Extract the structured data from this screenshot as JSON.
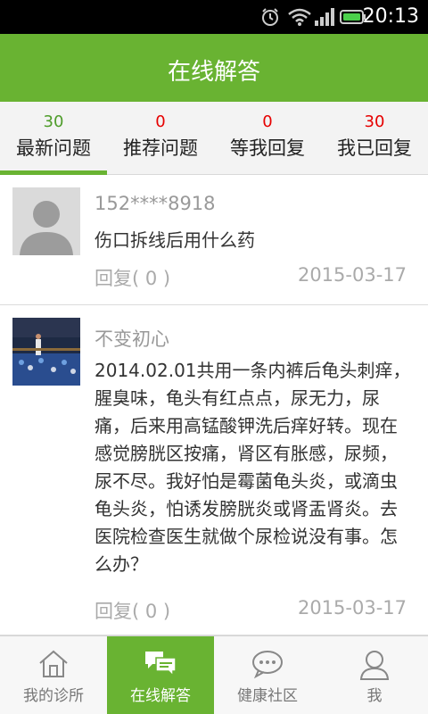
{
  "status_bar": {
    "time": "20:13"
  },
  "header": {
    "title": "在线解答"
  },
  "tabs": [
    {
      "count": "30",
      "label": "最新问题",
      "active": true
    },
    {
      "count": "0",
      "label": "推荐问题"
    },
    {
      "count": "0",
      "label": "等我回复"
    },
    {
      "count": "30",
      "label": "我已回复"
    }
  ],
  "questions": [
    {
      "user": "152****8918",
      "text": "伤口拆线后用什么药",
      "reply": "回复( 0 )",
      "date": "2015-03-17"
    },
    {
      "user": "不变初心",
      "text": "2014.02.01共用一条内裤后龟头刺痒，腥臭味，龟头有红点点，尿无力，尿痛，后来用高锰酸钾洗后痒好转。现在感觉膀胱区按痛，肾区有胀感，尿频，尿不尽。我好怕是霉菌龟头炎，或滴虫龟头炎，怕诱发膀胱炎或肾盂肾炎。去医院检查医生就做个尿检说没有事。怎么办？",
      "reply": "回复( 0 )",
      "date": "2015-03-17"
    }
  ],
  "bottom_nav": [
    {
      "label": "我的诊所",
      "icon": "home-icon"
    },
    {
      "label": "在线解答",
      "icon": "chat-bubbles-icon",
      "active": true
    },
    {
      "label": "健康社区",
      "icon": "chat-dots-icon"
    },
    {
      "label": "我",
      "icon": "user-icon"
    }
  ],
  "colors": {
    "accent": "#69b332",
    "count_red": "#e60000",
    "count_green": "#4e9c2a"
  }
}
